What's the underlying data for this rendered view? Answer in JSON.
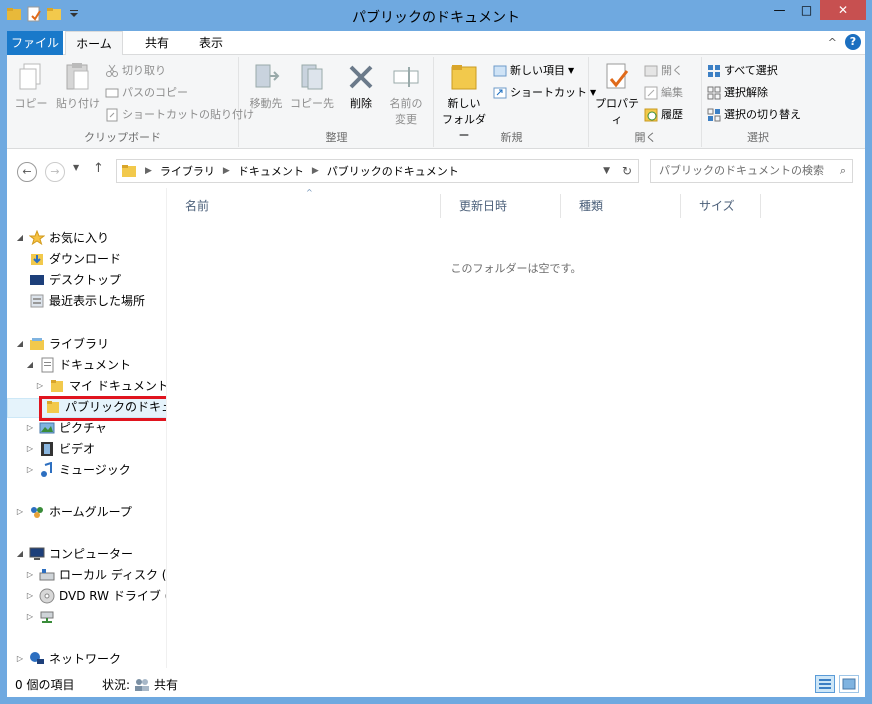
{
  "window": {
    "title": "パブリックのドキュメント",
    "minimize": "—",
    "maximize": "□",
    "close": "✕"
  },
  "ribbon_tabs": [
    {
      "label": "ファイル"
    },
    {
      "label": "ホーム"
    },
    {
      "label": "共有"
    },
    {
      "label": "表示"
    }
  ],
  "ribbon": {
    "help": "?",
    "collapse": "^",
    "clipboard": {
      "label": "クリップボード",
      "copy": "コピー",
      "paste": "貼り付け",
      "cut": "切り取り",
      "copy_path": "パスのコピー",
      "paste_shortcut": "ショートカットの貼り付け"
    },
    "organize": {
      "label": "整理",
      "move_to": "移動先",
      "copy_to": "コピー先",
      "delete": "削除",
      "rename_line1": "名前の",
      "rename_line2": "変更"
    },
    "new": {
      "label": "新規",
      "new_folder_line1": "新しい",
      "new_folder_line2": "フォルダー",
      "new_item": "新しい項目",
      "shortcut": "ショートカット"
    },
    "open": {
      "label": "開く",
      "properties": "プロパティ",
      "open": "開く",
      "edit": "編集",
      "history": "履歴"
    },
    "select": {
      "label": "選択",
      "select_all": "すべて選択",
      "select_none": "選択解除",
      "invert": "選択の切り替え"
    }
  },
  "address": {
    "crumbs": [
      "ライブラリ",
      "ドキュメント",
      "パブリックのドキュメント"
    ],
    "search_placeholder": "パブリックのドキュメントの検索"
  },
  "nav_tree": {
    "favorites": "お気に入り",
    "downloads": "ダウンロード",
    "desktop": "デスクトップ",
    "recent": "最近表示した場所",
    "libraries": "ライブラリ",
    "documents": "ドキュメント",
    "my_documents": "マイ ドキュメント",
    "public_documents": "パブリックのドキュメン",
    "pictures": "ピクチャ",
    "videos": "ビデオ",
    "music": "ミュージック",
    "homegroup": "ホームグループ",
    "computer": "コンピューター",
    "local_disk": "ローカル ディスク (C:)",
    "dvd": "DVD RW ドライブ (D",
    "network": "ネットワーク"
  },
  "columns": [
    "名前",
    "更新日時",
    "種類",
    "サイズ"
  ],
  "empty_message": "このフォルダーは空です。",
  "status": {
    "items": "0 個の項目",
    "state_label": "状況:",
    "state_value": "共有"
  },
  "colors": {
    "title_bar": "#6fa9e0",
    "file_tab": "#1979ca",
    "highlight": "#e0141e"
  }
}
